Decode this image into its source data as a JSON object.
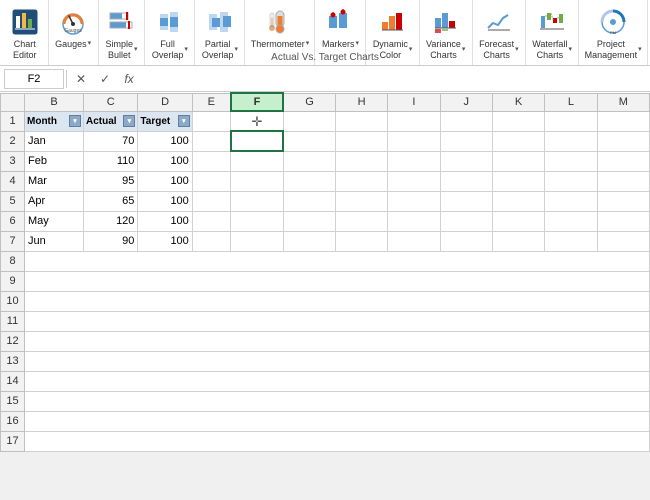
{
  "ribbon": {
    "title": "Actual Vs. Target Charts",
    "groups": [
      {
        "id": "chart-editor",
        "label": "Chart\nEditor",
        "type": "large-icon"
      },
      {
        "id": "gauges",
        "label": "Gauges",
        "type": "large-icon-drop"
      },
      {
        "id": "simple-bullet",
        "label": "Simple\nBullet",
        "type": "large-icon-drop"
      },
      {
        "id": "full-overlap",
        "label": "Full\nOverlap",
        "type": "large-icon-drop"
      },
      {
        "id": "partial-overlap",
        "label": "Partial\nOverlap",
        "type": "large-icon-drop"
      },
      {
        "id": "thermometer",
        "label": "Thermometer",
        "type": "large-icon-drop"
      },
      {
        "id": "markers",
        "label": "Markers",
        "type": "large-icon-drop"
      },
      {
        "id": "dynamic-color",
        "label": "Dynamic\nColor",
        "type": "large-icon-drop"
      },
      {
        "id": "variance-charts",
        "label": "Variance\nCharts",
        "type": "large-icon-drop"
      },
      {
        "id": "forecast-charts",
        "label": "Forecast\nCharts",
        "type": "large-icon-drop"
      },
      {
        "id": "waterfall-charts",
        "label": "Waterfall\nCharts",
        "type": "large-icon-drop"
      },
      {
        "id": "project-management",
        "label": "Project\nManagement",
        "type": "large-icon-drop"
      }
    ]
  },
  "formula_bar": {
    "name_box": "F2",
    "formula_text": ""
  },
  "spreadsheet": {
    "col_headers": [
      "",
      "B",
      "C",
      "D",
      "E",
      "F",
      "G",
      "H",
      "I",
      "J",
      "K",
      "L",
      "M"
    ],
    "data_headers": [
      {
        "col": "B",
        "label": "Month",
        "has_filter": true
      },
      {
        "col": "C",
        "label": "Actual",
        "has_filter": true
      },
      {
        "col": "D",
        "label": "Target",
        "has_filter": true
      }
    ],
    "rows": [
      {
        "row": 1,
        "B": "",
        "C": "",
        "D": ""
      },
      {
        "row": 2,
        "B": "Jan",
        "C": "70",
        "D": "100"
      },
      {
        "row": 3,
        "B": "Feb",
        "C": "110",
        "D": "100"
      },
      {
        "row": 4,
        "B": "Mar",
        "C": "95",
        "D": "100"
      },
      {
        "row": 5,
        "B": "Apr",
        "C": "65",
        "D": "100"
      },
      {
        "row": 6,
        "B": "May",
        "C": "120",
        "D": "100"
      },
      {
        "row": 7,
        "B": "Jun",
        "C": "90",
        "D": "100"
      }
    ],
    "selected_cell": "F2"
  },
  "colors": {
    "header_bg": "#dce6f1",
    "selected_border": "#217346",
    "ribbon_active": "#c55a11"
  }
}
